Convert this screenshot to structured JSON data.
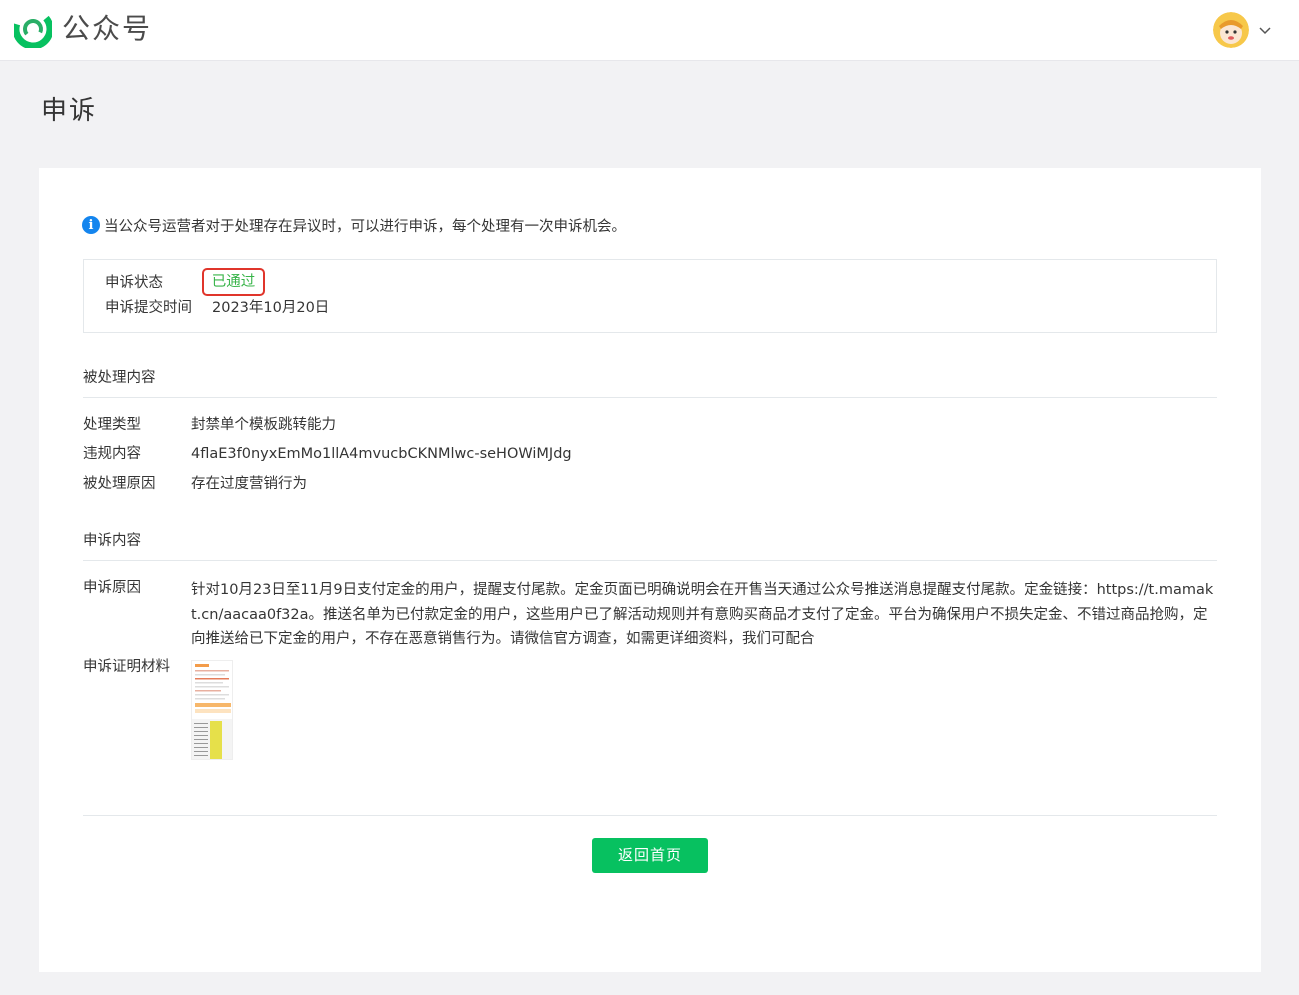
{
  "header": {
    "brand": "公众号"
  },
  "page": {
    "title": "申诉"
  },
  "notice": {
    "text": "当公众号运营者对于处理存在异议时，可以进行申诉，每个处理有一次申诉机会。"
  },
  "status": {
    "state_label": "申诉状态",
    "state_value": "已通过",
    "submit_label": "申诉提交时间",
    "submit_value": "2023年10月20日"
  },
  "processed": {
    "heading": "被处理内容",
    "rows": [
      {
        "label": "处理类型",
        "value": "封禁单个模板跳转能力"
      },
      {
        "label": "违规内容",
        "value": "4flaE3f0nyxEmMo1llA4mvucbCKNMlwc-seHOWiMJdg"
      },
      {
        "label": "被处理原因",
        "value": "存在过度营销行为"
      }
    ]
  },
  "appeal": {
    "heading": "申诉内容",
    "reason_label": "申诉原因",
    "reason_text": "针对10月23日至11月9日支付定金的用户，提醒支付尾款。定金页面已明确说明会在开售当天通过公众号推送消息提醒支付尾款。定金链接：https://t.mamakt.cn/aacaa0f32a。推送名单为已付款定金的用户，这些用户已了解活动规则并有意购买商品才支付了定金。平台为确保用户不损失定金、不错过商品抢购，定向推送给已下定金的用户，不存在恶意销售行为。请微信官方调查，如需更详细资料，我们可配合",
    "evidence_label": "申诉证明材料"
  },
  "actions": {
    "back_home": "返回首页"
  },
  "colors": {
    "primary_green": "#07c160",
    "passed_green": "#38b449",
    "highlight_red": "#e0352b",
    "info_blue": "#1485ee"
  }
}
